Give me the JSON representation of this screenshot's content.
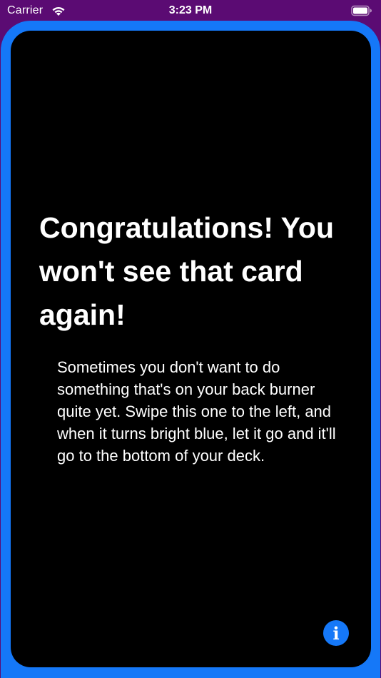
{
  "status_bar": {
    "carrier": "Carrier",
    "time": "3:23 PM",
    "wifi_icon": "wifi-icon",
    "battery_icon": "battery-icon"
  },
  "card": {
    "title": "Congratulations! You won't see that card again!",
    "body": "Sometimes you don't want to do something that's on your back burner quite yet. Swipe this one to the left, and when it turns bright blue, let it go and it'll go to the bottom of your deck.",
    "info_icon": "info-icon",
    "info_glyph": "i"
  },
  "colors": {
    "background": "#5b0b73",
    "card_border": "#1578f8",
    "card_fill": "#000000",
    "text": "#ffffff"
  }
}
